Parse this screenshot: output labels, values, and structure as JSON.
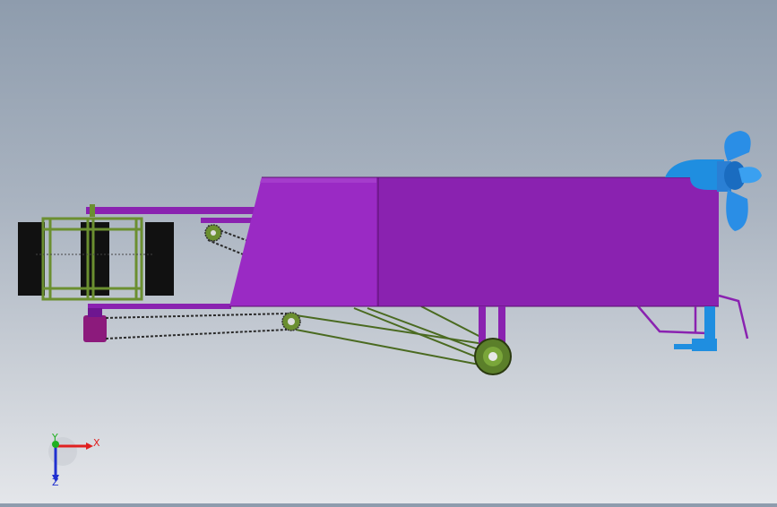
{
  "viewport": {
    "colors": {
      "body": "#8a22b0",
      "body_dark": "#6e1690",
      "body_light": "#a53ccc",
      "frame_green": "#5b7f2a",
      "paddle_black": "#111111",
      "pipe_blue": "#1f8ee0",
      "propeller_blue": "#2a7fd4",
      "magenta_block": "#8c1a7c"
    }
  },
  "triad": {
    "x_label": "X",
    "y_label": "Y",
    "z_label": "Z",
    "colors": {
      "x": "#e02020",
      "y": "#20b020",
      "z": "#2030d0"
    }
  }
}
